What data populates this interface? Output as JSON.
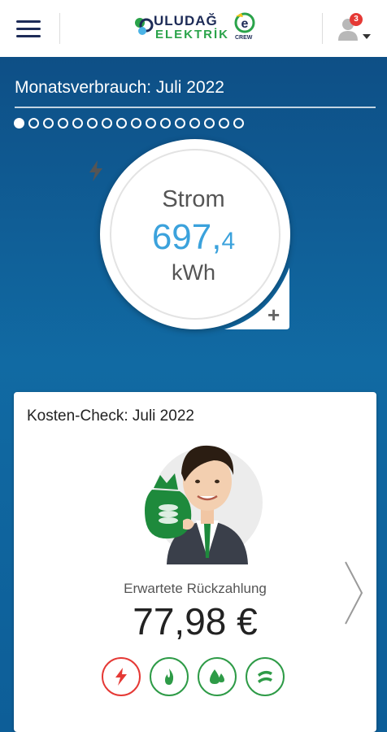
{
  "header": {
    "menu_icon": "hamburger-menu-icon",
    "logo_top": "ULUDAĞ",
    "logo_bottom": "ELEKTRİK",
    "logo_sub": "CREW",
    "notification_count": "3",
    "user_icon": "user-profile-icon"
  },
  "consumption": {
    "title": "Monatsverbrauch: Juli 2022",
    "page_dots": 16,
    "active_dot": 0,
    "energy_type": "Strom",
    "value_main": "697,",
    "value_decimal": "4",
    "unit": "kWh",
    "add_icon": "plus-icon"
  },
  "cost_check": {
    "title": "Kosten-Check: Juli 2022",
    "refund_label": "Erwartete Rückzahlung",
    "refund_value": "77,98 €",
    "next_icon": "chevron-right-icon",
    "energy_buttons": [
      {
        "name": "electricity",
        "icon": "lightning-icon",
        "color": "#e53935"
      },
      {
        "name": "gas",
        "icon": "flame-icon",
        "color": "#2e9b47"
      },
      {
        "name": "water",
        "icon": "water-drop-icon",
        "color": "#2e9b47"
      },
      {
        "name": "heat",
        "icon": "wind-wave-icon",
        "color": "#2e9b47"
      }
    ]
  },
  "colors": {
    "brand_navy": "#1d2b57",
    "brand_green": "#2aa34a",
    "hero_blue": "#0f5d96",
    "value_blue": "#3ba2dc"
  }
}
